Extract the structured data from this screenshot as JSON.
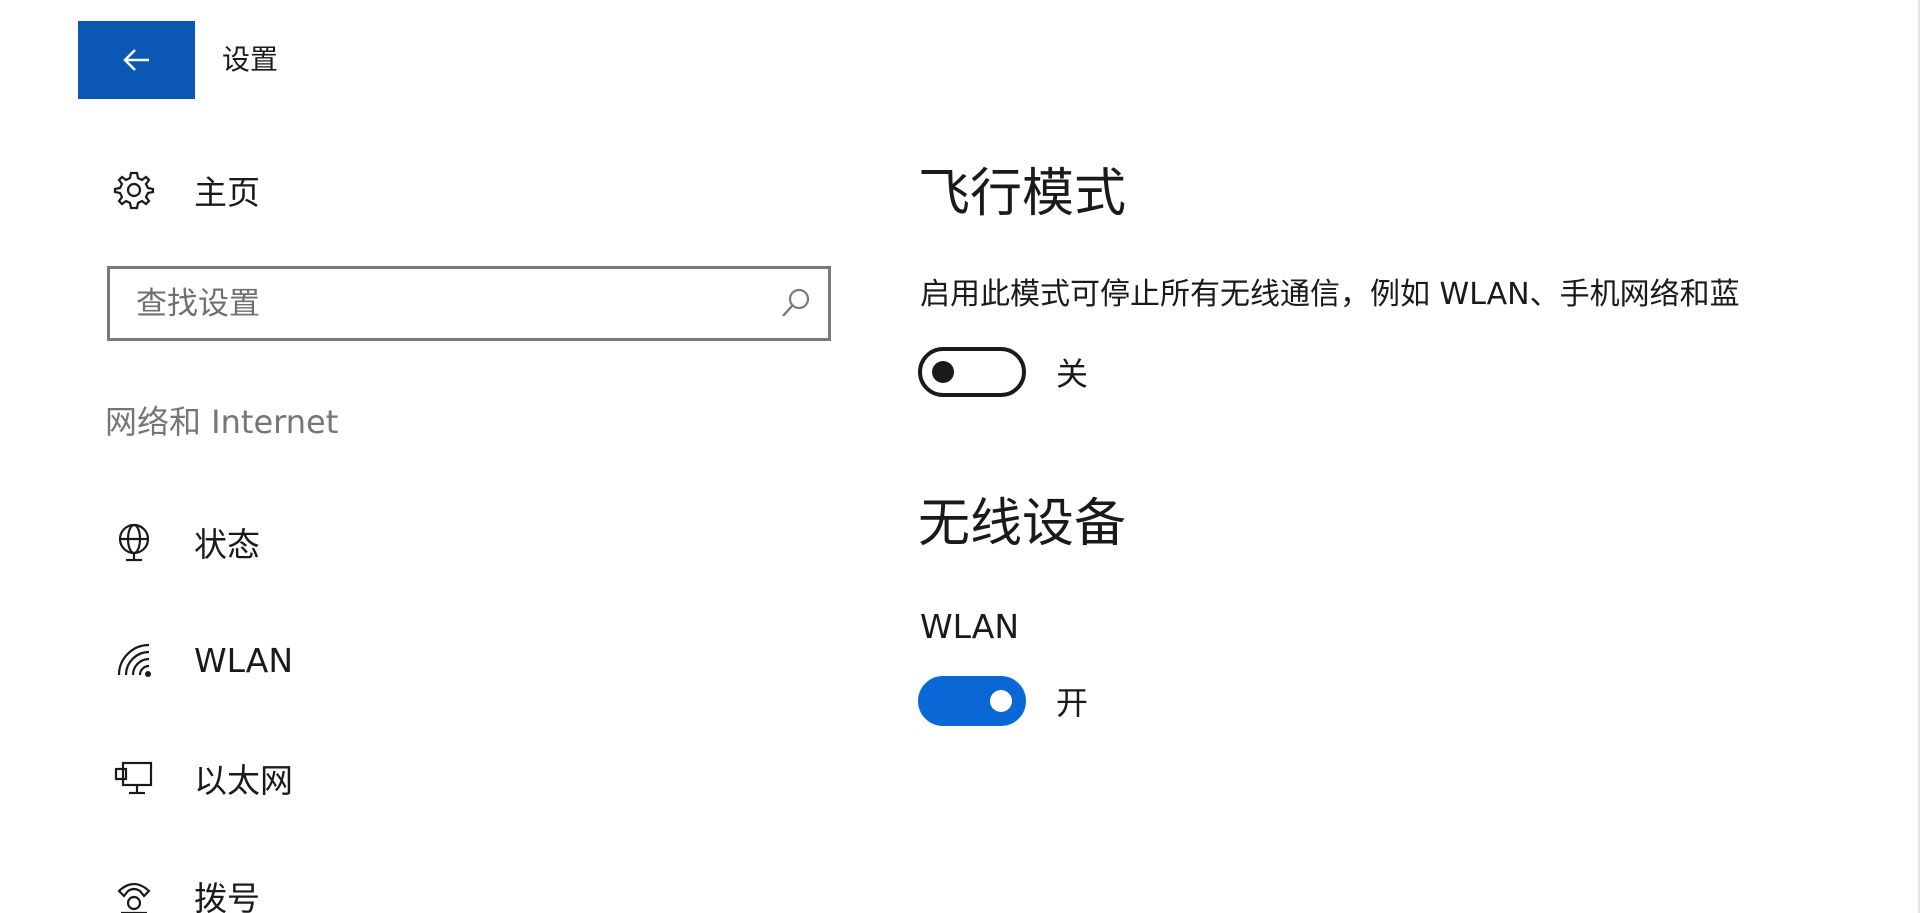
{
  "window": {
    "title": "设置"
  },
  "sidebar": {
    "home_label": "主页",
    "search": {
      "placeholder": "查找设置",
      "value": ""
    },
    "section_header": "网络和 Internet",
    "items": [
      {
        "label": "状态",
        "icon": "status-globe-icon"
      },
      {
        "label": "WLAN",
        "icon": "wifi-icon"
      },
      {
        "label": "以太网",
        "icon": "ethernet-icon"
      },
      {
        "label": "拨号",
        "icon": "dialup-phone-icon"
      }
    ]
  },
  "main": {
    "airplane_mode": {
      "title": "飞行模式",
      "description": "启用此模式可停止所有无线通信，例如 WLAN、手机网络和蓝",
      "toggle_state": "关",
      "is_on": false
    },
    "wireless_devices": {
      "title": "无线设备",
      "wlan_label": "WLAN",
      "toggle_state": "开",
      "is_on": true
    }
  },
  "colors": {
    "accent": "#0a57b4",
    "toggle_on": "#0a67d6",
    "secondary_text": "#767676",
    "border": "#7a7a7a"
  }
}
